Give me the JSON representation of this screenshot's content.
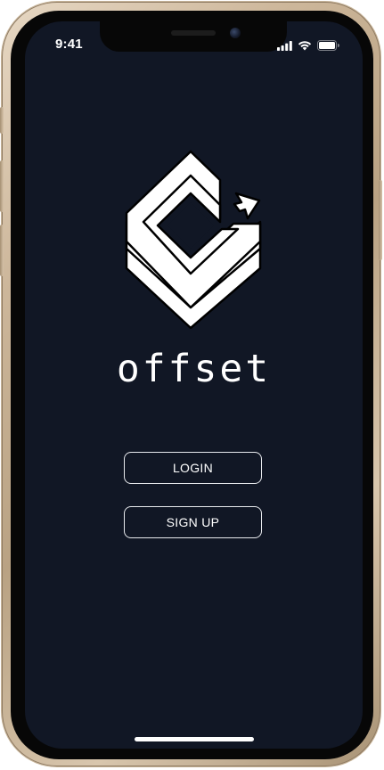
{
  "status_bar": {
    "time": "9:41",
    "icons": [
      "cellular-signal-icon",
      "wifi-icon",
      "battery-icon"
    ]
  },
  "app": {
    "name": "offset",
    "logo": "offset-logo"
  },
  "actions": {
    "login_label": "LOGIN",
    "signup_label": "SIGN UP"
  },
  "colors": {
    "background": "#111725",
    "foreground": "#ffffff",
    "bezel": "#070707",
    "frame": "#c9b394"
  }
}
